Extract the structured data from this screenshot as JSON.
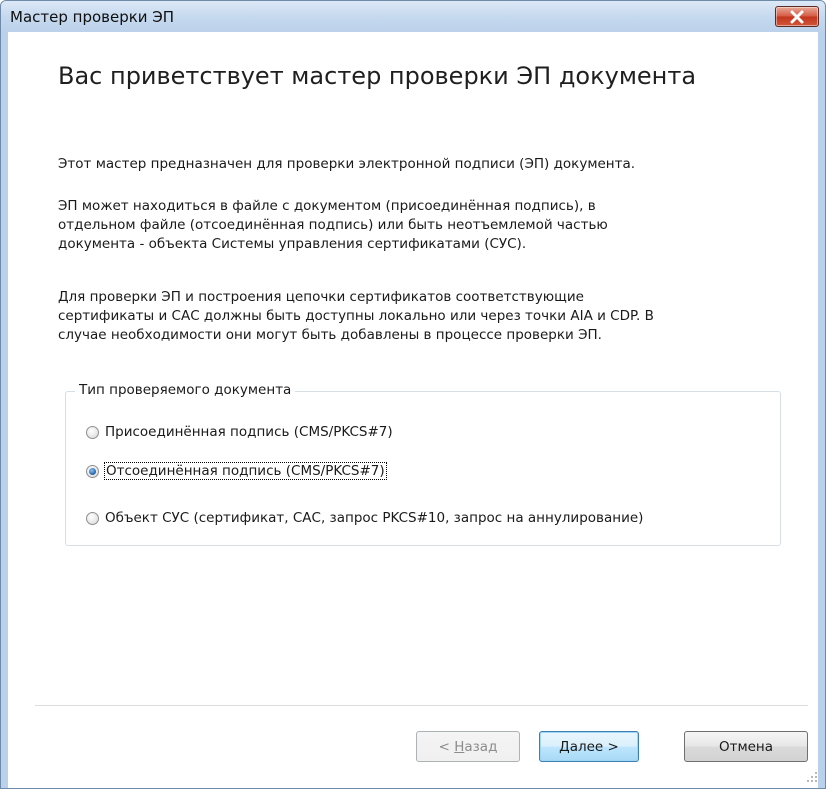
{
  "window": {
    "title": "Мастер проверки ЭП"
  },
  "content": {
    "heading": "Вас приветствует мастер проверки ЭП документа",
    "paragraph1": "Этот мастер предназначен для проверки электронной подписи (ЭП) документа.",
    "paragraph2_lines": [
      "ЭП может находиться в файле с документом (присоединённая подпись), в",
      "отдельном файле (отсоединённая подпись) или быть неотъемлемой частью",
      "документа - объекта Системы управления сертификатами (СУС)."
    ],
    "paragraph3_lines": [
      "Для проверки ЭП и построения цепочки сертификатов соответствующие",
      "сертификаты и САС должны быть доступны локально или через точки AIA и CDP. В",
      "случае необходимости они могут быть добавлены в процессе проверки ЭП."
    ]
  },
  "doc_type_group": {
    "legend": "Тип проверяемого документа",
    "options": [
      {
        "label": "Присоединённая подпись (CMS/PKCS#7)",
        "checked": false
      },
      {
        "label": "Отсоединённая подпись (CMS/PKCS#7)",
        "checked": true
      },
      {
        "label": "Объект СУС (сертификат, САС, запрос PKCS#10, запрос на аннулирование)",
        "checked": false
      }
    ]
  },
  "buttons": {
    "back_prefix": "< ",
    "back_accel": "Н",
    "back_rest": "азад",
    "next": "Далее >",
    "cancel": "Отмена"
  },
  "colors": {
    "accent": "#3c7fb1",
    "close_button": "#c2351c",
    "frame": "#b9d1ea"
  }
}
